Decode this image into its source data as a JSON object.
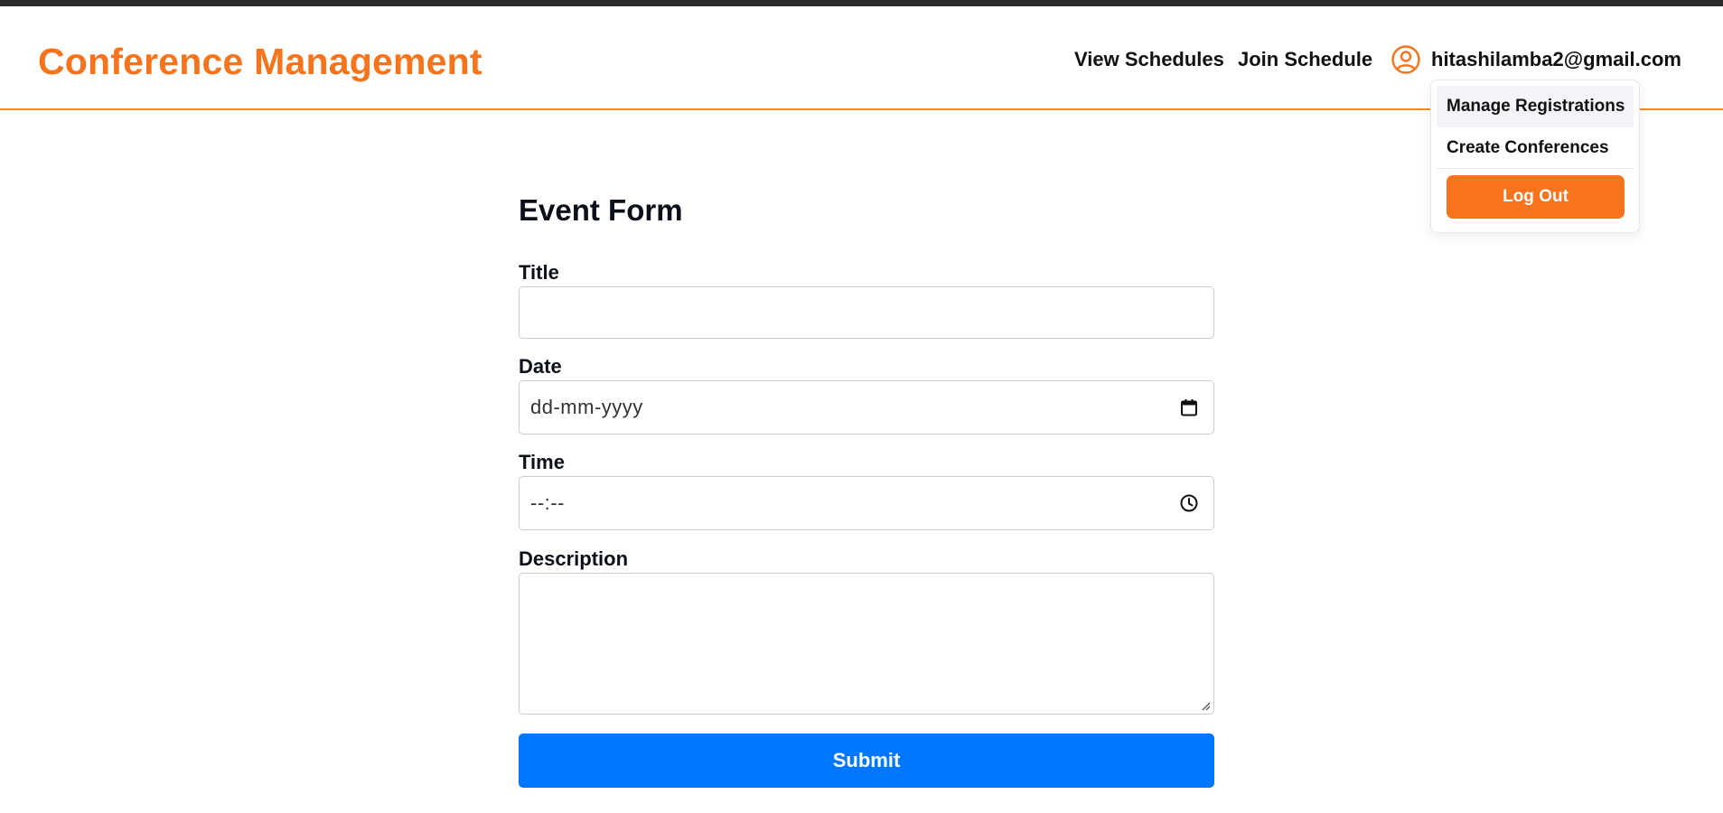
{
  "header": {
    "brand": "Conference Management",
    "nav": {
      "view_schedules": "View Schedules",
      "join_schedule": "Join Schedule"
    },
    "user": {
      "icon": "user-circle-icon",
      "email": "hitashilamba2@gmail.com"
    }
  },
  "user_menu": {
    "items": [
      "Manage Registrations",
      "Create Conferences"
    ],
    "logout": "Log Out"
  },
  "form": {
    "title": "Event Form",
    "fields": {
      "title": {
        "label": "Title",
        "value": ""
      },
      "date": {
        "label": "Date",
        "placeholder": "dd-mm-yyyy",
        "icon": "calendar-icon"
      },
      "time": {
        "label": "Time",
        "placeholder": "--:--",
        "icon": "clock-icon"
      },
      "description": {
        "label": "Description",
        "value": ""
      }
    },
    "submit": "Submit"
  },
  "colors": {
    "brand": "#f7731c",
    "primary_button": "#0077ff",
    "header_border": "#f0882d"
  }
}
